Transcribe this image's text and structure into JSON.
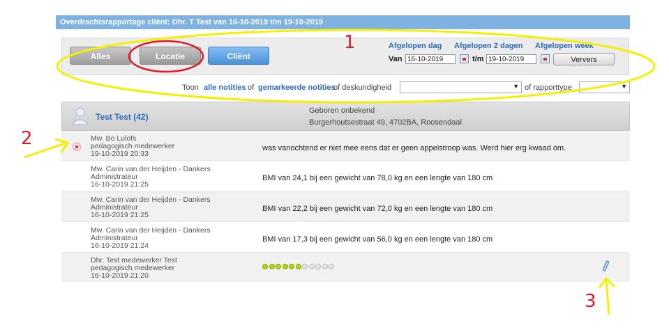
{
  "header": {
    "title": "Overdrachtsrapportage cliënt: Dhr. T Test van 16-10-2019 t/m 19-10-2019"
  },
  "filters": {
    "buttons": {
      "alles": "Alles",
      "locatie": "Locatie",
      "client": "Cliënt"
    },
    "periods": {
      "day": "Afgelopen dag",
      "two_days": "Afgelopen 2 dagen",
      "week": "Afgelopen week"
    },
    "from_label": "Van",
    "from_value": "16-10-2019",
    "to_label": "t/m",
    "to_value": "19-10-2019",
    "refresh": "Ververs",
    "line": {
      "toon": "Toon",
      "all_notes": "alle notities",
      "of1": "of",
      "marked_notes": "gemarkeerde notities",
      "of_expertise": "of deskundigheid",
      "of_type": "of rapporttype"
    }
  },
  "client": {
    "name": "Test Test (42)",
    "born": "Geboren onbekend",
    "address": "Burgerhoutsestraat 49, 4702BA, Roosendaal"
  },
  "notes": [
    {
      "author": "Mw. Bo Lulofs",
      "role": "pedagogisch medewerker",
      "date": "19-10-2019 20:33",
      "text": "was vanochtend er niet mee eens dat er geen appelstroop was. Werd hier erg kwaad om.",
      "marked": true
    },
    {
      "author": "Mw. Carin van der Heijden - Dankers",
      "role": "Administrateur",
      "date": "16-10-2019 21:25",
      "text": "BMI van 24,1 bij een gewicht van 78,0 kg en een lengte van 180 cm"
    },
    {
      "author": "Mw. Carin van der Heijden - Dankers",
      "role": "Administrateur",
      "date": "16-10-2019 21:25",
      "text": "BMI van 22,2 bij een gewicht van 72,0 kg en een lengte van 180 cm"
    },
    {
      "author": "Mw. Carin van der Heijden - Dankers",
      "role": "Administrateur",
      "date": "16-10-2019 21:24",
      "text": "BMI van 17,3 bij een gewicht van 56,0 kg en een lengte van 180 cm"
    },
    {
      "author": "Dhr. Test medewerker Test",
      "role": "pedagogisch medewerker",
      "date": "16-10-2019 21:20",
      "rating": 6,
      "rating_max": 11
    }
  ],
  "annotations": {
    "one": "1",
    "two": "2",
    "three": "3"
  },
  "colors": {
    "accent": "#2a6bbd",
    "titlebar": "#7fb2e0",
    "annotation_red": "#e0192a",
    "annotation_yellow": "#f5f000"
  }
}
